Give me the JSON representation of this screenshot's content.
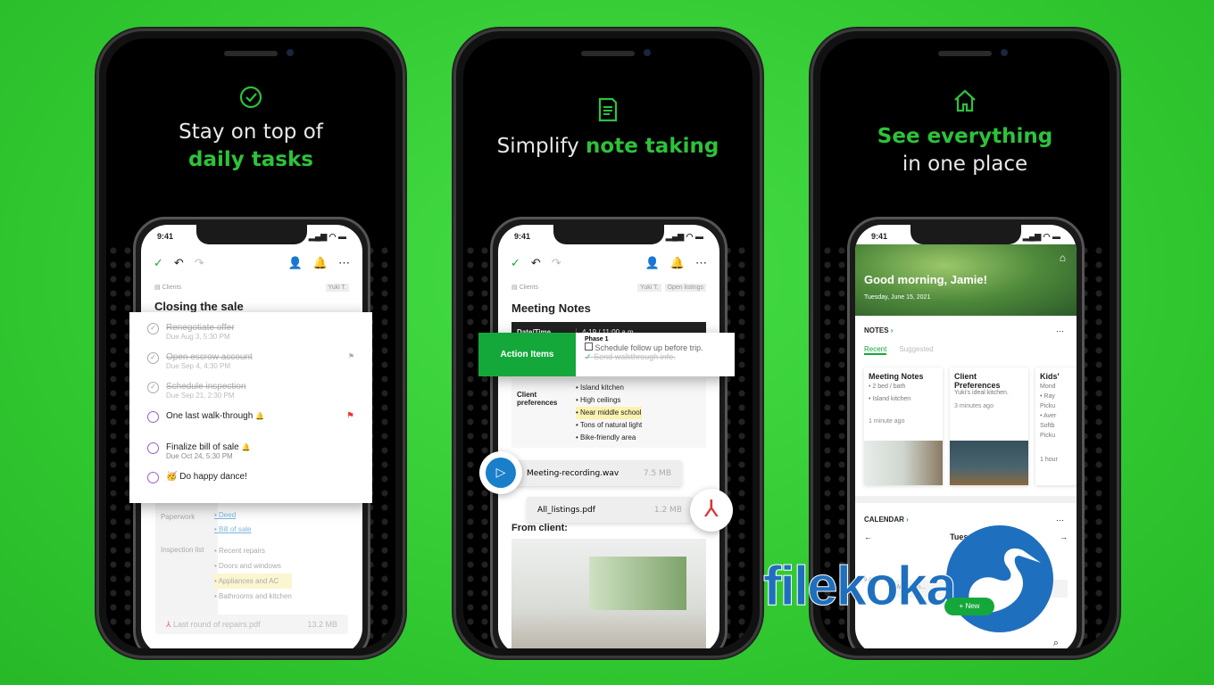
{
  "colors": {
    "background": "#36cc36",
    "accent": "#2dc23a",
    "evernote_green": "#14a83b",
    "watermark_blue": "#1f6fbf"
  },
  "panels": [
    {
      "icon": "check-circle-icon",
      "headline_line1": "Stay on top of",
      "headline_line2": "daily tasks",
      "status_time": "9:41",
      "breadcrumb": "Clients",
      "owner": "Yuki T.",
      "note_title": "Closing the sale",
      "tasks": [
        {
          "label": "Renegotiate offer",
          "due": "Due Aug 3, 5:30 PM",
          "done": true
        },
        {
          "label": "Open escrow account",
          "due": "Due Sep 4, 4:30 PM",
          "done": true
        },
        {
          "label": "Schedule inspection",
          "due": "Due Sep 21, 2:30 PM",
          "done": true
        },
        {
          "label": "One last walk-through",
          "due": "",
          "done": false
        },
        {
          "label": "Finalize bill of sale",
          "due": "Due Oct 24, 5:30 PM",
          "done": false
        },
        {
          "label": "Do happy dance!",
          "due": "",
          "done": false,
          "emoji": "🥳"
        }
      ],
      "paperwork_label": "Paperwork",
      "paperwork_items": [
        "Deed",
        "Bill of sale"
      ],
      "inspection_label": "Inspection list",
      "inspection_items": [
        "Recent repairs",
        "Doors and windows",
        "Appliances and AC",
        "Bathrooms and kitchen"
      ],
      "attachment": {
        "name": "Last round of repairs.pdf",
        "size": "13.2 MB"
      }
    },
    {
      "icon": "note-icon",
      "headline_plain": "Simplify ",
      "headline_green": "note taking",
      "status_time": "9:41",
      "breadcrumb": "Clients",
      "tags": [
        "Yuki T.",
        "Open listings"
      ],
      "note_title": "Meeting Notes",
      "table": {
        "date_label": "Date/Time",
        "date_value": "4-19 / 11:00 a.m.",
        "action_label": "Action Items",
        "phase": "Phase 1",
        "checklist": [
          {
            "label": "Schedule follow up before trip.",
            "done": false
          },
          {
            "label": "Send walkthrough info.",
            "done": true
          }
        ],
        "pref_label": "Client preferences",
        "prefs": [
          "Island kitchen",
          "High ceilings",
          "Near middle school",
          "Tons of natural light",
          "Bike-friendly area"
        ]
      },
      "files": [
        {
          "name": "Meeting-recording.wav",
          "size": "7.5 MB"
        },
        {
          "name": "All_listings.pdf",
          "size": "1.2 MB"
        }
      ],
      "from_client": "From client:"
    },
    {
      "icon": "home-icon",
      "headline_line1": "See everything",
      "headline_line2": "in one place",
      "status_time": "9:41",
      "greeting": "Good morning, Jamie!",
      "date": "Tuesday, June 15, 2021",
      "notes_heading": "NOTES",
      "tabs": [
        "Recent",
        "Suggested"
      ],
      "note_cards": [
        {
          "title": "Meeting Notes",
          "lines": [
            "• 2 bed / bath",
            "• Island kitchen"
          ],
          "time": "1 minute ago"
        },
        {
          "title": "Client Preferences",
          "lines": [
            "Yuki's ideal kitchen."
          ],
          "time": "3 minutes ago"
        },
        {
          "title": "Kids'",
          "lines": [
            "Mond",
            "• Ray",
            "Picku",
            "• Aver",
            "Softb",
            "Picku"
          ],
          "time": "1 hour"
        }
      ],
      "calendar_heading": "CALENDAR",
      "calendar_day": "Tuesday",
      "calendar_time": "9 AM",
      "calendar_event": "Work ren...",
      "new_button": "New"
    }
  ],
  "watermark": "filekoka"
}
